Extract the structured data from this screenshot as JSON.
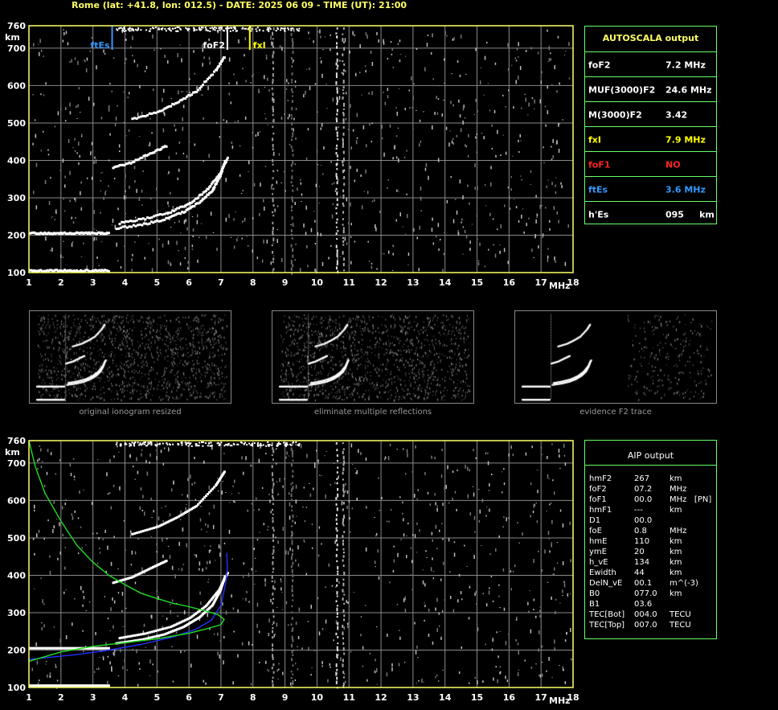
{
  "header": "Rome (lat: +41.8, lon: 012.5) - DATE: 2025 06 09 - TIME (UT): 21:00",
  "colors": {
    "axis": "#ffff66",
    "grid": "#8a8a8a",
    "panel_border": "#66ff66",
    "ftEs": "#3399ff",
    "fxI": "#ffff00",
    "foF1": "#ff2222",
    "foF2": "#ffffff",
    "profile": "#2233ff",
    "model": "#22dd22"
  },
  "chart_data": [
    {
      "type": "scatter",
      "title": "ionogram",
      "xlabel": "MHz",
      "ylabel": "km",
      "xlim": [
        1,
        18
      ],
      "ylim": [
        100,
        760
      ],
      "xticks": [
        "1",
        "2",
        "3",
        "4",
        "5",
        "6",
        "7",
        "8",
        "9",
        "10",
        "11",
        "12",
        "13",
        "14",
        "15",
        "16",
        "17",
        "18"
      ],
      "yticks": [
        "100",
        "200",
        "300",
        "400",
        "500",
        "600",
        "700",
        "760"
      ],
      "grid": true,
      "markers": [
        {
          "label": "ftEs",
          "x": 3.6,
          "color": "#3399ff"
        },
        {
          "label": "foF2",
          "x": 7.2,
          "color": "#ffffff"
        },
        {
          "label": "fxI",
          "x": 7.9,
          "color": "#ffff00"
        }
      ],
      "traces": [
        {
          "name": "Es",
          "points": [
            [
              1.0,
              105
            ],
            [
              1.5,
              105
            ],
            [
              2.0,
              105
            ],
            [
              2.5,
              105
            ],
            [
              3.0,
              105
            ],
            [
              3.5,
              105
            ]
          ]
        },
        {
          "name": "Es2",
          "points": [
            [
              1.0,
              205
            ],
            [
              1.5,
              205
            ],
            [
              2.0,
              205
            ],
            [
              2.5,
              205
            ],
            [
              3.0,
              205
            ],
            [
              3.5,
              205
            ]
          ]
        },
        {
          "name": "F2o",
          "points": [
            [
              3.7,
              218
            ],
            [
              4.5,
              228
            ],
            [
              5.2,
              242
            ],
            [
              5.8,
              262
            ],
            [
              6.3,
              288
            ],
            [
              6.7,
              320
            ],
            [
              6.95,
              360
            ],
            [
              7.1,
              400
            ]
          ]
        },
        {
          "name": "F2x",
          "points": [
            [
              3.8,
              232
            ],
            [
              4.6,
              244
            ],
            [
              5.4,
              262
            ],
            [
              6.0,
              286
            ],
            [
              6.5,
              318
            ],
            [
              6.9,
              360
            ],
            [
              7.2,
              410
            ]
          ]
        },
        {
          "name": "F2mult",
          "points": [
            [
              3.6,
              380
            ],
            [
              4.2,
              395
            ],
            [
              4.8,
              420
            ],
            [
              5.3,
              440
            ]
          ]
        },
        {
          "name": "F2mult2",
          "points": [
            [
              4.2,
              510
            ],
            [
              5.0,
              530
            ],
            [
              5.6,
              555
            ],
            [
              6.2,
              585
            ],
            [
              6.8,
              640
            ],
            [
              7.1,
              680
            ]
          ]
        }
      ]
    },
    {
      "type": "line",
      "title": "AIP",
      "xlabel": "MHz",
      "ylabel": "km",
      "xlim": [
        1,
        18
      ],
      "ylim": [
        100,
        760
      ],
      "xticks": [
        "1",
        "2",
        "3",
        "4",
        "5",
        "6",
        "7",
        "8",
        "9",
        "10",
        "11",
        "12",
        "13",
        "14",
        "15",
        "16",
        "17",
        "18"
      ],
      "yticks": [
        "100",
        "200",
        "300",
        "400",
        "500",
        "600",
        "700",
        "760"
      ],
      "grid": true,
      "series": [
        {
          "points": [
            [
              1.0,
              175
            ],
            [
              2.5,
              188
            ],
            [
              3.5,
              200
            ],
            [
              4.5,
              215
            ],
            [
              5.5,
              235
            ],
            [
              6.2,
              255
            ],
            [
              6.7,
              280
            ],
            [
              7.0,
              320
            ],
            [
              7.15,
              380
            ],
            [
              7.2,
              420
            ],
            [
              7.18,
              460
            ]
          ],
          "color": "#2233ff"
        },
        {
          "points": [
            [
              1.0,
              760
            ],
            [
              1.2,
              690
            ],
            [
              1.5,
              620
            ],
            [
              2.0,
              545
            ],
            [
              2.5,
              480
            ],
            [
              3.0,
              435
            ],
            [
              3.5,
              400
            ],
            [
              4.0,
              375
            ],
            [
              4.5,
              352
            ],
            [
              5.0,
              338
            ],
            [
              5.5,
              325
            ],
            [
              6.0,
              316
            ],
            [
              6.5,
              305
            ],
            [
              6.9,
              295
            ],
            [
              7.1,
              282
            ],
            [
              7.0,
              268
            ],
            [
              6.6,
              258
            ],
            [
              6.0,
              245
            ],
            [
              5.0,
              230
            ],
            [
              4.0,
              220
            ],
            [
              3.0,
              210
            ],
            [
              2.0,
              195
            ],
            [
              1.0,
              170
            ]
          ],
          "color": "#22dd22"
        }
      ]
    }
  ],
  "autoscala": {
    "title": "AUTOSCALA output",
    "rows": [
      {
        "label": "foF2",
        "value": "7.2 MHz",
        "color": "#ffffff"
      },
      {
        "label": "MUF(3000)F2",
        "value": "24.6 MHz",
        "color": "#ffffff"
      },
      {
        "label": "M(3000)F2",
        "value": "3.42",
        "color": "#ffffff"
      },
      {
        "label": "fxI",
        "value": "7.9 MHz",
        "color": "#ffff00"
      },
      {
        "label": "foF1",
        "value": "NO",
        "color": "#ff2222"
      },
      {
        "label": "ftEs",
        "value": "3.6 MHz",
        "color": "#3399ff"
      },
      {
        "label": "h'Es",
        "value": "095     km",
        "color": "#ffffff"
      }
    ]
  },
  "thumbs": [
    {
      "caption": "original ionogram resized"
    },
    {
      "caption": "eliminate multiple reflections"
    },
    {
      "caption": "evidence F2 trace"
    }
  ],
  "aip": {
    "title": "AIP output",
    "rows": [
      {
        "name": "hmF2",
        "value": "267",
        "unit": "km"
      },
      {
        "name": "foF2",
        "value": "07.2",
        "unit": "MHz"
      },
      {
        "name": "foF1",
        "value": "00.0",
        "unit": "MHz   [PN]"
      },
      {
        "name": "hmF1",
        "value": "---",
        "unit": "km"
      },
      {
        "name": "D1",
        "value": "00.0",
        "unit": ""
      },
      {
        "name": "foE",
        "value": "0.8",
        "unit": "MHz"
      },
      {
        "name": "hmE",
        "value": "110",
        "unit": "km"
      },
      {
        "name": "ymE",
        "value": "20",
        "unit": "km"
      },
      {
        "name": "h_vE",
        "value": "134",
        "unit": "km"
      },
      {
        "name": "Ewidth",
        "value": "44",
        "unit": "km"
      },
      {
        "name": "DelN_vE",
        "value": "00.1",
        "unit": "m^(-3)"
      },
      {
        "name": "B0",
        "value": "077.0",
        "unit": "km"
      },
      {
        "name": "B1",
        "value": "03.6",
        "unit": ""
      },
      {
        "name": "TEC[Bot]",
        "value": "004.0",
        "unit": "TECU"
      },
      {
        "name": "TEC[Top]",
        "value": "007.0",
        "unit": "TECU"
      }
    ]
  }
}
